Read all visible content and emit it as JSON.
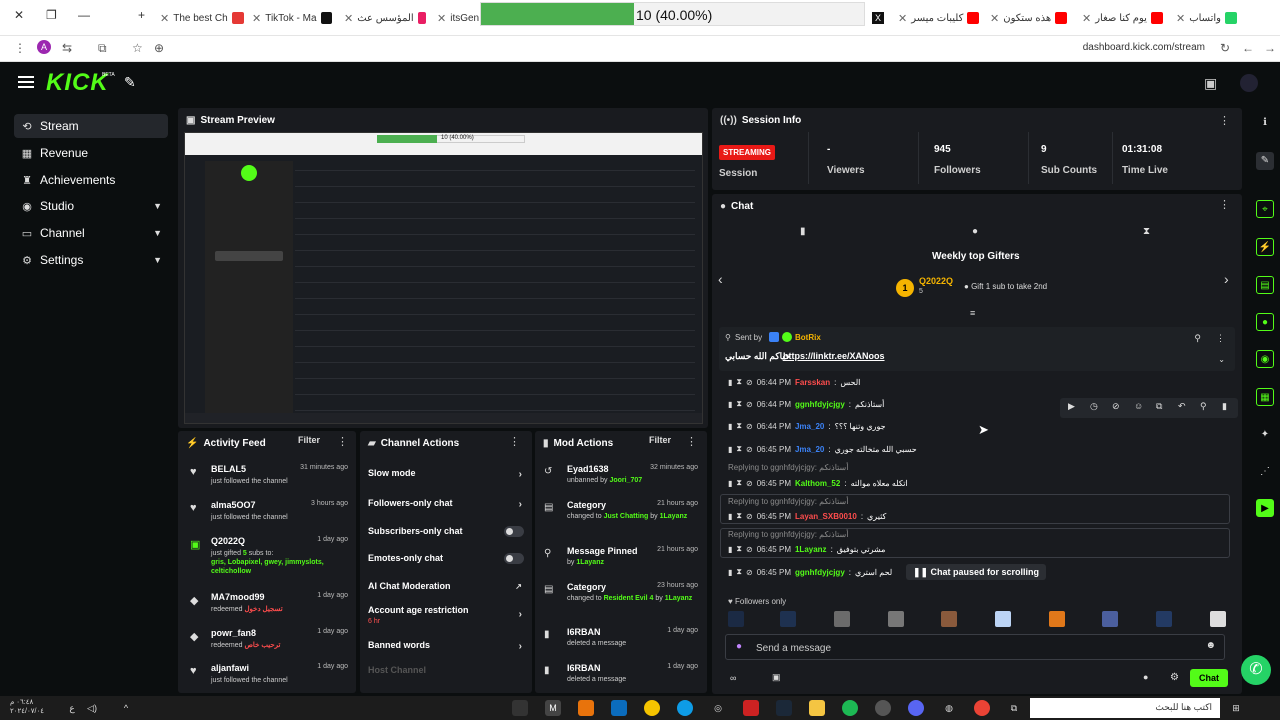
{
  "browser": {
    "tabs": [
      {
        "label": "The best Ch",
        "color": "#e53935"
      },
      {
        "label": "TikTok - Ma",
        "color": "#111111"
      },
      {
        "label": "المؤسس عث",
        "color": "#e91e63"
      },
      {
        "label": "itsGend",
        "color": "#333333"
      },
      {
        "label": "كليبات ميسر",
        "color": "#ff0000"
      },
      {
        "label": "هذه ستكون",
        "color": "#ff0000"
      },
      {
        "label": "يوم كنا صغار",
        "color": "#ff0000"
      },
      {
        "label": "واتساب",
        "color": "#25d366"
      }
    ],
    "download": {
      "text": "10 (40.00%)",
      "progress": 0.4
    },
    "url": "dashboard.kick.com/stream",
    "profile_initial": "A"
  },
  "header": {
    "logo": "KICK",
    "beta": "BETA"
  },
  "nav": {
    "items": [
      {
        "label": "Stream",
        "icon": "stream-icon",
        "glyph": "⟲",
        "active": true
      },
      {
        "label": "Revenue",
        "icon": "revenue-icon",
        "glyph": "▦"
      },
      {
        "label": "Achievements",
        "icon": "trophy-icon",
        "glyph": "🏆"
      },
      {
        "label": "Studio",
        "icon": "studio-icon",
        "glyph": "◉",
        "chevron": true
      },
      {
        "label": "Channel",
        "icon": "channel-icon",
        "glyph": "▭",
        "chevron": true
      },
      {
        "label": "Settings",
        "icon": "gear-icon",
        "glyph": "⚙",
        "chevron": true
      }
    ]
  },
  "preview": {
    "title": "Stream Preview",
    "dl_text": "10 (40.00%)"
  },
  "session": {
    "title": "Session Info",
    "streaming": "STREAMING",
    "session_label": "Session",
    "viewers_value": "-",
    "viewers_label": "Viewers",
    "followers_value": "945",
    "followers_label": "Followers",
    "subs_value": "9",
    "subs_label": "Sub Counts",
    "time_value": "01:31:08",
    "time_label": "Time Live"
  },
  "chat": {
    "title": "Chat",
    "gifters_title": "Weekly top Gifters",
    "top_gifter": {
      "rank": "1",
      "name": "Q2022Q",
      "count": "5"
    },
    "gift_hint": "Gift 1 sub to take 2nd",
    "pinned": {
      "sent_by": "Sent by",
      "bot": "BotRix",
      "arabic": "حياكم الله حسابي",
      "link": "https://linktr.ee/XANoos"
    },
    "messages": [
      {
        "time": "06:44 PM",
        "user": "Farsskan",
        "user_color": "#ff4d4d",
        "text": "الحس"
      },
      {
        "time": "06:44 PM",
        "user": "ggnhfdyjcjgy",
        "user_color": "#53fc18",
        "text": "أستاذنكم"
      },
      {
        "time": "06:44 PM",
        "user": "Jma_20",
        "user_color": "#3b82f6",
        "text": "جوري وتنها ؟؟؟"
      },
      {
        "time": "06:45 PM",
        "user": "Jma_20",
        "user_color": "#3b82f6",
        "text": "حسبي الله متخالته جوري"
      },
      {
        "time": "06:45 PM",
        "user": "Kalthom_52",
        "user_color": "#53fc18",
        "text": "اتكله معلاه موالته",
        "reply": "Replying to ggnhfdyjcjgy: أستاذنكم"
      },
      {
        "time": "06:45 PM",
        "user": "Layan_SXB0010",
        "user_color": "#ff4d4d",
        "text": "كثيري",
        "reply": "Replying to ggnhfdyjcjgy: أستاذنكم"
      },
      {
        "time": "06:45 PM",
        "user": "1Layanz",
        "user_color": "#53fc18",
        "text": "مشرتي بتوفيق",
        "reply": "Replying to ggnhfdyjcjgy: أستاذنكم"
      },
      {
        "time": "06:45 PM",
        "user": "ggnhfdyjcjgy",
        "user_color": "#53fc18",
        "text": "لحم استري"
      }
    ],
    "paused": "Chat paused for scrolling",
    "followers_only": "Followers only",
    "placeholder": "Send a message",
    "chat_button": "Chat"
  },
  "activity": {
    "title": "Activity Feed",
    "filter": "Filter",
    "items": [
      {
        "name": "BELAL5",
        "time": "31 minutes ago",
        "desc": "just followed the channel",
        "icon": "heart-icon",
        "glyph": "♥"
      },
      {
        "name": "alma5OO7",
        "time": "3 hours ago",
        "desc": "just followed the channel",
        "icon": "heart-icon",
        "glyph": "♥"
      },
      {
        "name": "Q2022Q",
        "time": "1 day ago",
        "desc_pre": "just gifted ",
        "desc_hl": "5",
        "desc_mid": " subs to:",
        "desc_names": "gris, Lobapixel, gwey, jimmyslots, celtichollow",
        "icon": "gift-icon",
        "glyph": "▣"
      },
      {
        "name": "MA7mood99",
        "time": "1 day ago",
        "desc_pre": "redeemed ",
        "desc_red": "تسجيل دخول",
        "icon": "redeem-icon",
        "glyph": "◆"
      },
      {
        "name": "powr_fan8",
        "time": "1 day ago",
        "desc_pre": "redeemed ",
        "desc_red": "ترحيب خاص",
        "icon": "redeem-icon",
        "glyph": "◆"
      },
      {
        "name": "aljanfawi",
        "time": "1 day ago",
        "desc": "just followed the channel",
        "icon": "heart-icon",
        "glyph": "♥"
      }
    ]
  },
  "channel_actions": {
    "title": "Channel Actions",
    "items": [
      {
        "label": "Slow mode",
        "kind": "chevron"
      },
      {
        "label": "Followers-only chat",
        "kind": "chevron"
      },
      {
        "label": "Subscribers-only chat",
        "kind": "toggle"
      },
      {
        "label": "Emotes-only chat",
        "kind": "toggle"
      },
      {
        "label": "AI Chat Moderation",
        "kind": "link"
      },
      {
        "label": "Account age restriction",
        "kind": "chevron",
        "sub": "6 hr"
      },
      {
        "label": "Banned words",
        "kind": "chevron"
      },
      {
        "label": "Host Channel",
        "kind": "none",
        "disabled": true
      }
    ]
  },
  "mod_actions": {
    "title": "Mod Actions",
    "filter": "Filter",
    "items": [
      {
        "title": "Eyad1638",
        "time": "32 minutes ago",
        "desc_pre": "unbanned by ",
        "desc_hl": "Joori_707",
        "icon": "unban-icon",
        "glyph": "↺"
      },
      {
        "title": "Category",
        "time": "21 hours ago",
        "desc_pre": "changed to ",
        "desc_hl": "Just Chatting",
        "desc_post": " by ",
        "desc_by": "1Layanz",
        "icon": "category-icon",
        "glyph": "▤"
      },
      {
        "title": "Message Pinned",
        "time": "21 hours ago",
        "desc_pre": "by ",
        "desc_hl": "1Layanz",
        "icon": "pin-icon",
        "glyph": "⚲"
      },
      {
        "title": "Category",
        "time": "23 hours ago",
        "desc_pre": "changed to ",
        "desc_hl": "Resident Evil 4",
        "desc_post": " by ",
        "desc_by": "1Layanz",
        "icon": "category-icon",
        "glyph": "▤"
      },
      {
        "title": "I6RBAN",
        "time": "1 day ago",
        "desc": "deleted a message",
        "icon": "trash-icon",
        "glyph": "🗑"
      },
      {
        "title": "I6RBAN",
        "time": "1 day ago",
        "desc": "deleted a message",
        "icon": "trash-icon",
        "glyph": "🗑"
      }
    ]
  },
  "taskbar": {
    "clock_time": "٠٦:٤٨ م",
    "clock_date": "٢٠٢٤/٠٧/٠٤",
    "search_placeholder": "اكتب هنا للبحث"
  },
  "colors": {
    "accent": "#53fc18",
    "live": "#e91916",
    "panel": "#191b1f",
    "bg": "#0b0e0f"
  }
}
